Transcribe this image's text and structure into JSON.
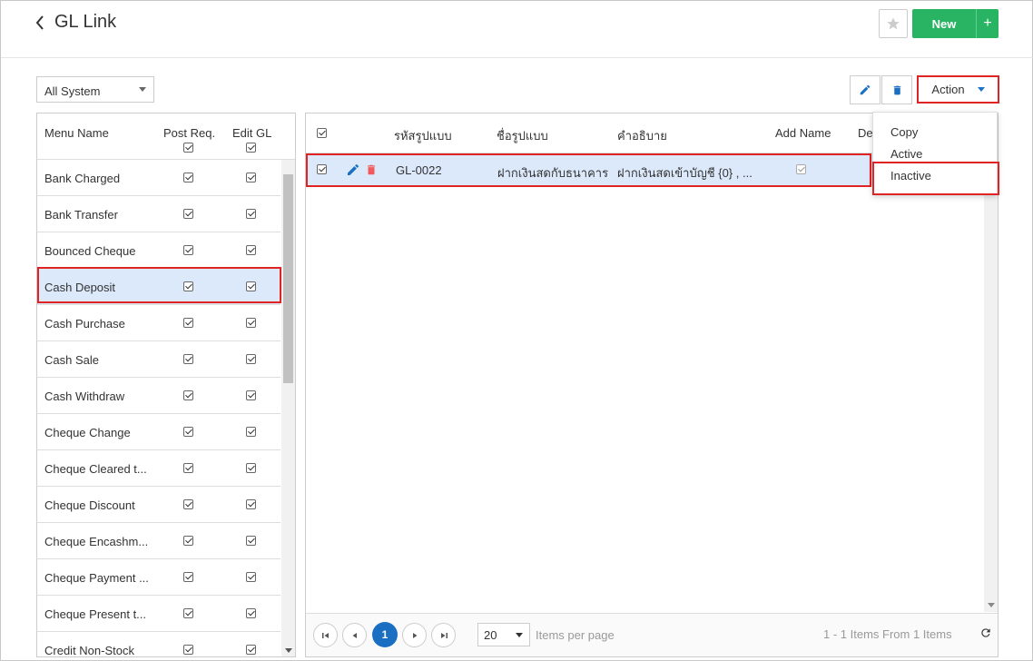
{
  "header": {
    "title": "GL Link",
    "new_label": "New",
    "plus_label": "+"
  },
  "filter": {
    "system_value": "All System"
  },
  "toolbar": {
    "action_label": "Action"
  },
  "action_menu": {
    "items": [
      "Copy",
      "Active",
      "Inactive"
    ],
    "highlighted": "Inactive"
  },
  "left_panel": {
    "columns": [
      "Menu Name",
      "Post Req.",
      "Edit GL"
    ],
    "rows": [
      {
        "name": "Bank Charged",
        "post_req": true,
        "edit_gl": true
      },
      {
        "name": "Bank Transfer",
        "post_req": true,
        "edit_gl": true
      },
      {
        "name": "Bounced Cheque",
        "post_req": true,
        "edit_gl": true
      },
      {
        "name": "Cash Deposit",
        "post_req": true,
        "edit_gl": true,
        "selected": true
      },
      {
        "name": "Cash Purchase",
        "post_req": true,
        "edit_gl": true
      },
      {
        "name": "Cash Sale",
        "post_req": true,
        "edit_gl": true
      },
      {
        "name": "Cash Withdraw",
        "post_req": true,
        "edit_gl": true
      },
      {
        "name": "Cheque Change",
        "post_req": true,
        "edit_gl": true
      },
      {
        "name": "Cheque Cleared t...",
        "post_req": true,
        "edit_gl": true
      },
      {
        "name": "Cheque Discount",
        "post_req": true,
        "edit_gl": true
      },
      {
        "name": "Cheque Encashm...",
        "post_req": true,
        "edit_gl": true
      },
      {
        "name": "Cheque Payment ...",
        "post_req": true,
        "edit_gl": true
      },
      {
        "name": "Cheque Present t...",
        "post_req": true,
        "edit_gl": true
      },
      {
        "name": "Credit Non-Stock",
        "post_req": true,
        "edit_gl": true
      }
    ]
  },
  "right_panel": {
    "columns": [
      "รหัสรูปแบบ",
      "ชื่อรูปแบบ",
      "คำอธิบาย",
      "Add Name",
      "De"
    ],
    "rows": [
      {
        "code": "GL-0022",
        "name": "ฝากเงินสดกับธนาคาร",
        "description": "ฝากเงินสดเข้าบัญชี {0} , ...",
        "add_name": true
      }
    ]
  },
  "pager": {
    "current_page": "1",
    "per_page": "20",
    "per_page_label": "Items per page",
    "info": "1 - 1 Items From 1 Items"
  },
  "colors": {
    "primary_green": "#28b463",
    "highlight_red": "#e02424",
    "selection_blue": "#dce9fb",
    "page_blue": "#1a6fc2"
  }
}
